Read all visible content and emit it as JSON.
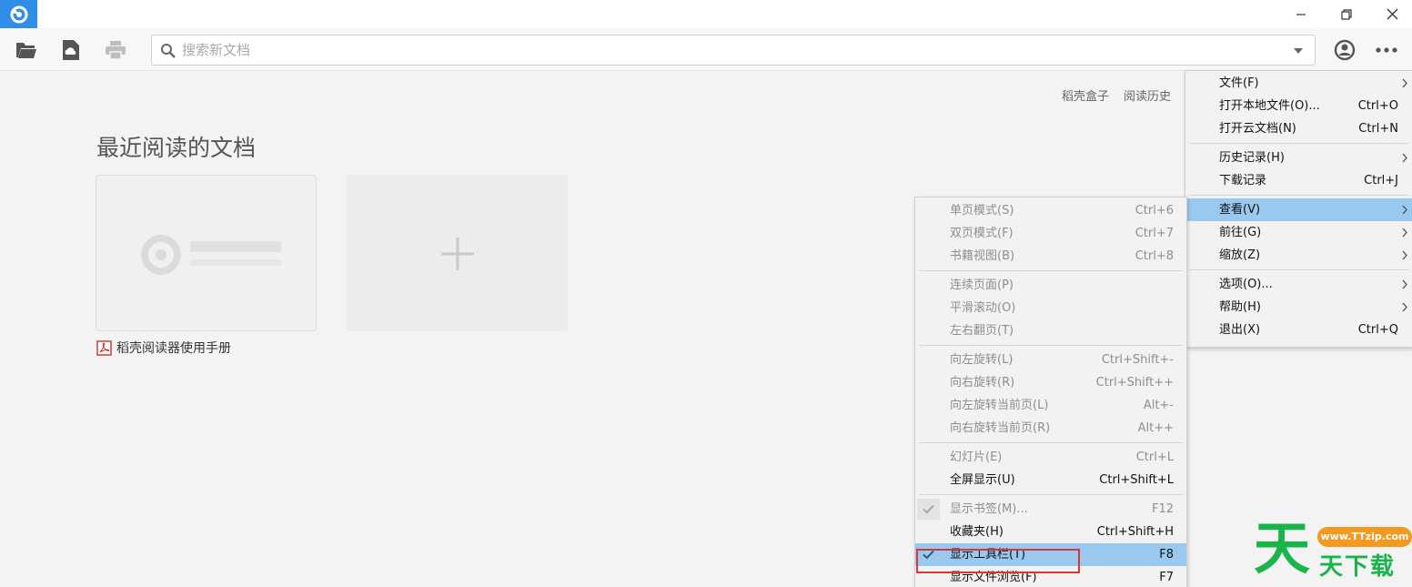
{
  "titlebar": {
    "logo_icon": "daoke-logo-icon",
    "minimize_icon": "minimize-icon",
    "maximize_icon": "restore-icon",
    "close_icon": "close-icon"
  },
  "toolbar": {
    "search_placeholder": "搜索新文档",
    "icons": [
      "folder-open-icon",
      "cloud-upload-icon",
      "printer-icon",
      "account-icon",
      "more-icon"
    ]
  },
  "main": {
    "top_links": [
      "稻壳盒子",
      "阅读历史"
    ],
    "section_title": "最近阅读的文档",
    "recent_doc_label": "稻壳阅读器使用手册"
  },
  "main_menu": {
    "items": [
      {
        "label": "文件(F)",
        "shortcut": "",
        "submenu": true
      },
      {
        "label": "打开本地文件(O)...",
        "shortcut": "Ctrl+O"
      },
      {
        "label": "打开云文档(N)",
        "shortcut": "Ctrl+N"
      },
      {
        "label": "历史记录(H)",
        "shortcut": "",
        "submenu": true
      },
      {
        "label": "下载记录",
        "shortcut": "Ctrl+J"
      },
      {
        "label": "查看(V)",
        "shortcut": "",
        "submenu": true,
        "active": true
      },
      {
        "label": "前往(G)",
        "shortcut": "",
        "submenu": true
      },
      {
        "label": "缩放(Z)",
        "shortcut": "",
        "submenu": true
      },
      {
        "label": "选项(O)...",
        "shortcut": "",
        "submenu": true
      },
      {
        "label": "帮助(H)",
        "shortcut": "",
        "submenu": true
      },
      {
        "label": "退出(X)",
        "shortcut": "Ctrl+Q"
      }
    ]
  },
  "view_submenu": {
    "items": [
      {
        "label": "单页模式(S)",
        "shortcut": "Ctrl+6",
        "disabled": true
      },
      {
        "label": "双页模式(F)",
        "shortcut": "Ctrl+7",
        "disabled": true
      },
      {
        "label": "书籍视图(B)",
        "shortcut": "Ctrl+8",
        "disabled": true
      },
      {
        "label": "连续页面(P)",
        "shortcut": "",
        "disabled": true
      },
      {
        "label": "平滑滚动(O)",
        "shortcut": "",
        "disabled": true
      },
      {
        "label": "左右翻页(T)",
        "shortcut": "",
        "disabled": true
      },
      {
        "label": "向左旋转(L)",
        "shortcut": "Ctrl+Shift+-",
        "disabled": true
      },
      {
        "label": "向右旋转(R)",
        "shortcut": "Ctrl+Shift++",
        "disabled": true
      },
      {
        "label": "向左旋转当前页(L)",
        "shortcut": "Alt+-",
        "disabled": true
      },
      {
        "label": "向右旋转当前页(R)",
        "shortcut": "Alt++",
        "disabled": true
      },
      {
        "label": "幻灯片(E)",
        "shortcut": "Ctrl+L",
        "disabled": true
      },
      {
        "label": "全屏显示(U)",
        "shortcut": "Ctrl+Shift+L"
      },
      {
        "label": "显示书签(M)...",
        "shortcut": "F12",
        "disabled": true,
        "checked": true
      },
      {
        "label": "收藏夹(H)",
        "shortcut": "Ctrl+Shift+H"
      },
      {
        "label": "显示工具栏(T)",
        "shortcut": "F8",
        "checked": true,
        "active": true
      },
      {
        "label": "显示文件浏览(F)",
        "shortcut": "F7"
      }
    ]
  },
  "watermark": {
    "big_char": "天",
    "url": "www.TTzip.com",
    "text": "天下载"
  },
  "colors": {
    "accent": "#2f8ee8",
    "menu_highlight": "#99c9ef",
    "annotation_red": "#d9363a",
    "watermark_green": "#19b54a",
    "watermark_orange": "#f19a1f"
  }
}
